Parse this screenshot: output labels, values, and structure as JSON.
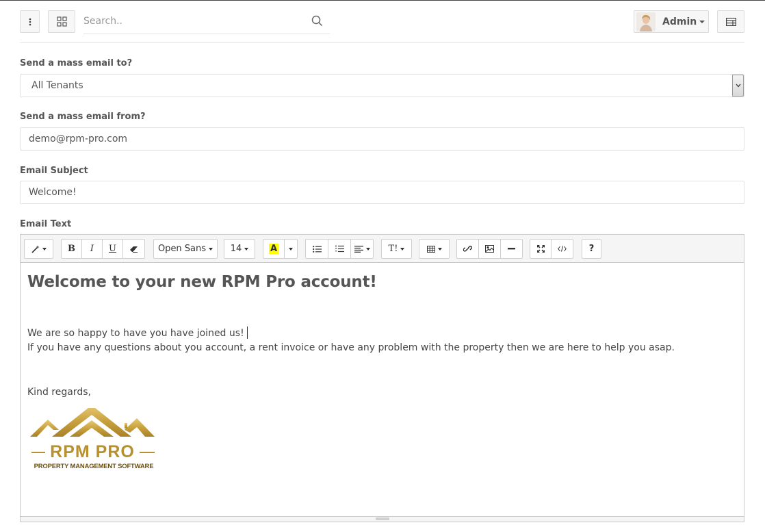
{
  "topbar": {
    "menu_icon": "dots-vertical-icon",
    "grid_icon": "grid-icon",
    "search": {
      "placeholder": "Search..",
      "value": "",
      "icon": "search-icon"
    },
    "user": {
      "name": "Admin",
      "avatar": "avatar"
    },
    "panel_icon": "list-panel-icon"
  },
  "form": {
    "to": {
      "label": "Send a mass email to?",
      "value": "All Tenants"
    },
    "from": {
      "label": "Send a mass email from?",
      "value": "demo@rpm-pro.com"
    },
    "subject": {
      "label": "Email Subject",
      "value": "Welcome!"
    },
    "body_label": "Email Text"
  },
  "toolbar": {
    "font_name": "Open Sans",
    "font_size": "14",
    "color_letter": "A",
    "bold": "B",
    "italic": "I",
    "underline": "U",
    "style": "T!",
    "help": "?"
  },
  "editor": {
    "heading": "Welcome to your new RPM Pro account!",
    "line1": "We are so happy to have you have joined us!",
    "line2": "If you have any questions about you account, a rent invoice or have any problem with the property then we are here to help you asap.",
    "closing": "Kind regards,",
    "logo": {
      "name": "RPM PRO",
      "tagline": "PROPERTY MANAGEMENT SOFTWARE"
    }
  },
  "colors": {
    "accent_gold": "#c9a23e",
    "highlight_yellow": "#ffff00",
    "border": "#e2e2e2"
  }
}
